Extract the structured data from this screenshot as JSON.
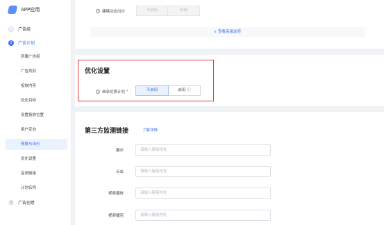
{
  "app": {
    "title": "APP应用"
  },
  "sidebar": {
    "steps": [
      {
        "label": "广告组",
        "num": "✓"
      },
      {
        "label": "广告计划",
        "num": "2"
      },
      {
        "label": "广告创意",
        "num": "3"
      }
    ],
    "sub_items": [
      "所属广告组",
      "广告类别",
      "投放内容",
      "优化目标",
      "设置投放位置",
      "用户定向",
      "预算与出价",
      "优化设置",
      "监测链接",
      "计划名称"
    ]
  },
  "bid_section": {
    "dynamic_bid_label": "建模动态出价",
    "options": [
      "不启用",
      "启用"
    ],
    "advanced_link": "∨ 查看高级选项"
  },
  "optimize_section": {
    "title": "优化设置",
    "field_label": "继承优质计划",
    "required_mark": "*",
    "options": [
      "不启用",
      "启用 ⓘ"
    ]
  },
  "monitor_section": {
    "title": "第三方监测链接",
    "detail_link": "了解详情",
    "fields": [
      {
        "label": "展示",
        "placeholder": "请输入链接地址"
      },
      {
        "label": "点击",
        "placeholder": "请输入链接地址"
      },
      {
        "label": "视频播放",
        "placeholder": "请输入链接地址"
      },
      {
        "label": "视频播完",
        "placeholder": "请输入链接地址"
      }
    ]
  },
  "colors": {
    "accent": "#3a73f0",
    "highlight": "#e2333f",
    "selected_bg": "#eaf1ff"
  }
}
